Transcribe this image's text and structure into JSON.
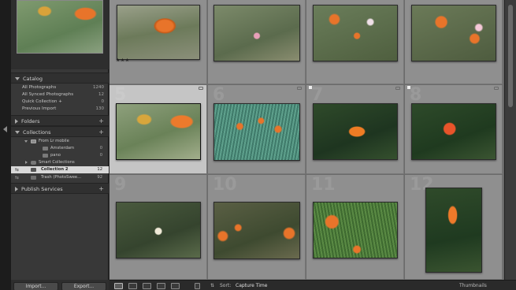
{
  "catalog": {
    "title": "Catalog",
    "items": [
      {
        "label": "All Photographs",
        "count": "1240"
      },
      {
        "label": "All Synced Photographs",
        "count": "12"
      },
      {
        "label": "Quick Collection +",
        "count": "0"
      },
      {
        "label": "Previous Import",
        "count": "130"
      }
    ]
  },
  "folders": {
    "title": "Folders"
  },
  "collections": {
    "title": "Collections",
    "items": [
      {
        "label": "From Lr mobile",
        "count": ""
      },
      {
        "label": "Amsterdam",
        "count": "0"
      },
      {
        "label": "pano",
        "count": "0"
      },
      {
        "label": "Smart Collections",
        "count": ""
      },
      {
        "label": "Collection 2",
        "count": "12"
      },
      {
        "label": "Trash (PhotoSwee...",
        "count": "92"
      }
    ]
  },
  "publish": {
    "title": "Publish Services"
  },
  "buttons": {
    "import": "Import...",
    "export": "Export..."
  },
  "grid": {
    "cell_numbers": [
      "5",
      "6",
      "7",
      "8",
      "9",
      "10",
      "11",
      "12"
    ],
    "first_row_rating": "★★★",
    "selected_cell": 5
  },
  "toolbar": {
    "sort_label": "Sort:",
    "sort_value": "Capture Time",
    "thumbnails_label": "Thumbnails"
  },
  "colors": {
    "panel_bg": "#383838",
    "grid_bg": "#8f8f8f",
    "selected_cell": "#c5c5c5",
    "selected_row": "#d8d8d8",
    "poppy_orange": "#e8742a"
  }
}
